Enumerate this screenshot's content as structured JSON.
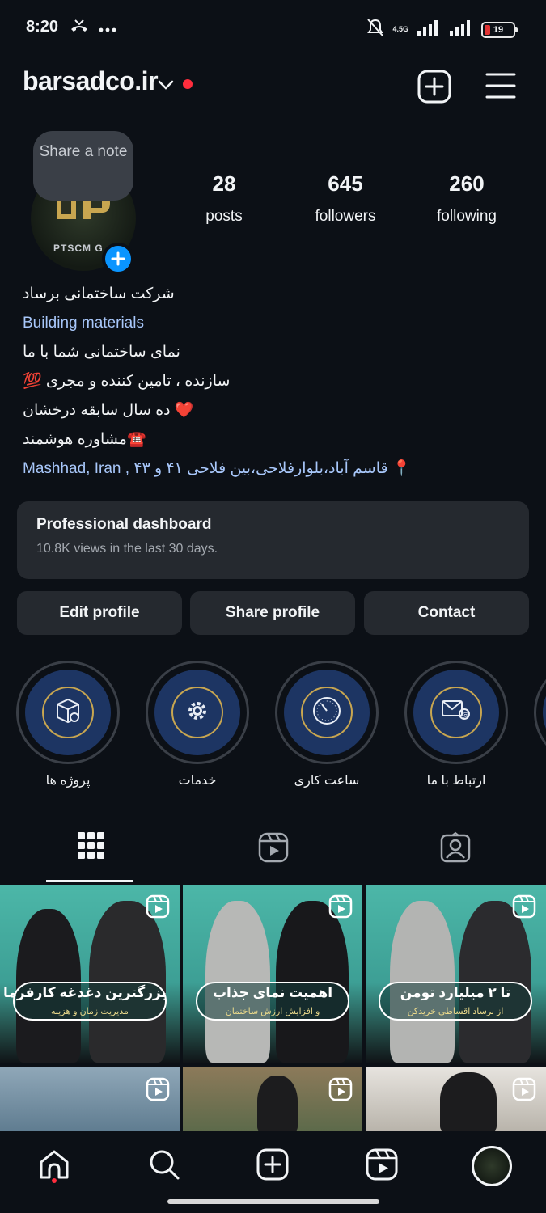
{
  "status_bar": {
    "time": "8:20",
    "network": "4.5G",
    "battery_level": "19",
    "icons": [
      "missed-call-icon",
      "more-dots-icon",
      "mute-bell-icon",
      "signal-icon",
      "battery-icon"
    ]
  },
  "header": {
    "username": "barsadco.ir",
    "icons": [
      "chevron-down-icon",
      "notification-dot",
      "add-post-icon",
      "menu-icon"
    ]
  },
  "profile": {
    "note_label": "Share a note",
    "avatar_text": "PTSCM G",
    "stats": [
      {
        "value": "28",
        "label": "posts"
      },
      {
        "value": "645",
        "label": "followers"
      },
      {
        "value": "260",
        "label": "following"
      }
    ]
  },
  "bio": {
    "name": "شرکت ساختمانی برساد",
    "category": "Building materials",
    "lines": [
      "نمای ساختمانی شما با ما",
      "سازنده ، تامین کننده و مجری 💯",
      "❤️ ده سال سابقه درخشان",
      "☎️مشاوره هوشمند"
    ],
    "location": "📍 قاسم آباد،بلوارفلاحی،بین فلاحی ۴۱ و ۴۳ , Mashhad, Iran"
  },
  "dashboard": {
    "title": "Professional dashboard",
    "subtitle": "10.8K views in the last 30 days."
  },
  "actions": {
    "edit": "Edit profile",
    "share": "Share profile",
    "contact": "Contact"
  },
  "highlights": [
    {
      "label": "پروژه ها",
      "icon": "box-icon"
    },
    {
      "label": "خدمات",
      "icon": "gear-icon"
    },
    {
      "label": "ساعت کاری",
      "icon": "clock-icon"
    },
    {
      "label": "ارتباط با ما",
      "icon": "contact-icon"
    }
  ],
  "tabs": [
    "grid-icon",
    "reels-icon",
    "tagged-icon"
  ],
  "posts": [
    {
      "caption": "بزرگترین دغدغه کارفرما",
      "sub": "مدیریت زمان و هزینه"
    },
    {
      "caption": "اهمیت نمای جذاب",
      "sub": "و افزایش ارزش ساختمان"
    },
    {
      "caption": "تا ۲ میلیارد تومن",
      "sub": "از برساد اقساطی خریدکن"
    }
  ],
  "bottom_nav": [
    "home-icon",
    "search-icon",
    "create-icon",
    "reels-icon",
    "profile-avatar"
  ],
  "colors": {
    "background": "#0c1016",
    "card": "#25292f",
    "link": "#a8c7fa",
    "accent_blue": "#0a95ff",
    "notification_red": "#ff2d3d",
    "highlight_navy": "#1d3563",
    "highlight_gold": "#c8a650",
    "post_teal": "#3aa79a"
  }
}
